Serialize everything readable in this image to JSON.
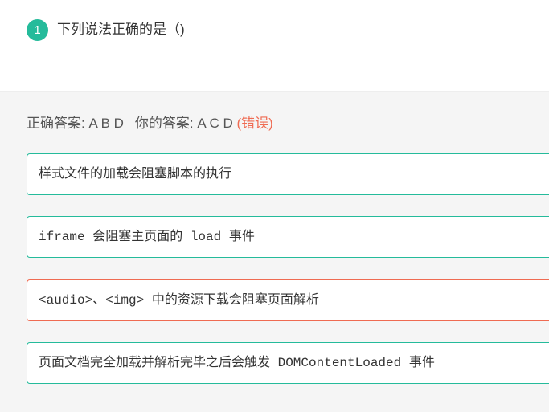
{
  "question": {
    "number": "1",
    "title": "下列说法正确的是（)"
  },
  "summary": {
    "correct_label": "正确答案: ",
    "correct_value": "A B D",
    "yours_label": "你的答案: ",
    "yours_value": "A C D",
    "status": "(错误)"
  },
  "colors": {
    "accent": "#25bb9b",
    "error": "#ef6b52",
    "background": "#f5f5f5"
  },
  "options": [
    {
      "text": "样式文件的加载会阻塞脚本的执行",
      "state": "correct-selected"
    },
    {
      "text": "iframe 会阻塞主页面的 load 事件",
      "state": "correct-missed"
    },
    {
      "text": "<audio>、<img> 中的资源下载会阻塞页面解析",
      "state": "wrong-selected"
    },
    {
      "text": "页面文档完全加载并解析完毕之后会触发 DOMContentLoaded 事件",
      "state": "correct-selected"
    }
  ]
}
